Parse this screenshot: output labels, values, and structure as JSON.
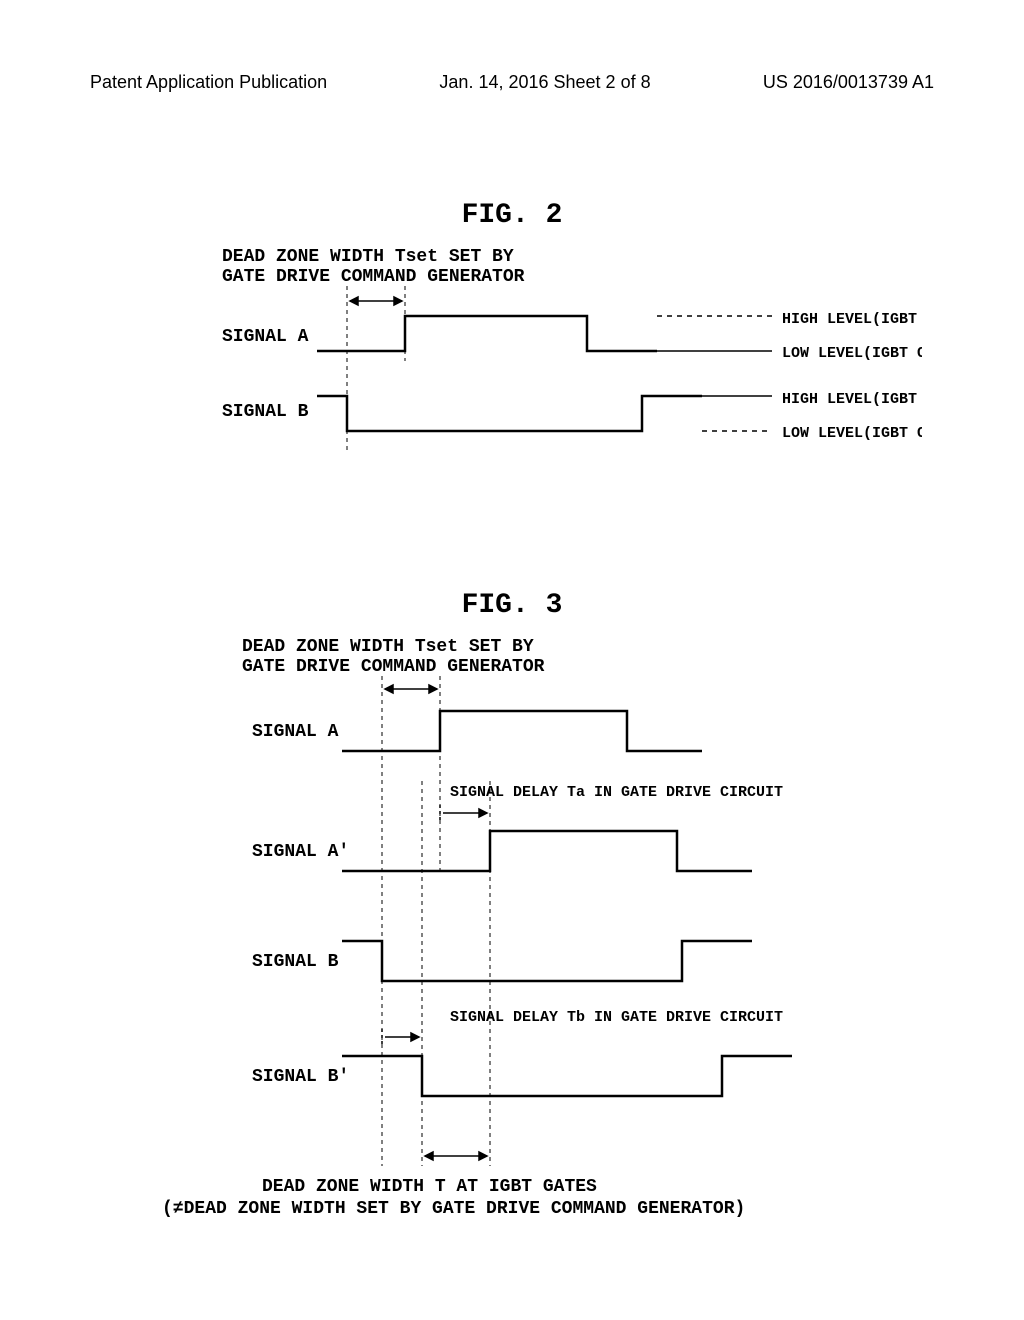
{
  "header": {
    "left": "Patent Application Publication",
    "center": "Jan. 14, 2016   Sheet 2 of 8",
    "right": "US 2016/0013739 A1"
  },
  "fig2": {
    "title": "FIG. 2",
    "caption_line1": "DEAD ZONE WIDTH Tset SET BY",
    "caption_line2": "GATE DRIVE COMMAND GENERATOR",
    "signal_a": "SIGNAL A",
    "signal_b": "SIGNAL B",
    "high_on": "HIGH LEVEL(IGBT ON)",
    "low_off": "LOW LEVEL(IGBT OFF)"
  },
  "fig3": {
    "title": "FIG. 3",
    "caption_line1": "DEAD ZONE WIDTH Tset SET BY",
    "caption_line2": "GATE DRIVE COMMAND GENERATOR",
    "signal_a": "SIGNAL A",
    "signal_ap": "SIGNAL A'",
    "signal_b": "SIGNAL B",
    "signal_bp": "SIGNAL B'",
    "delay_ta": "SIGNAL DELAY Ta IN GATE DRIVE CIRCUIT",
    "delay_tb": "SIGNAL DELAY Tb IN GATE DRIVE CIRCUIT",
    "bottom_line1": "DEAD ZONE WIDTH T AT IGBT GATES",
    "bottom_line2": "(≠DEAD ZONE WIDTH SET BY GATE DRIVE COMMAND GENERATOR)"
  }
}
